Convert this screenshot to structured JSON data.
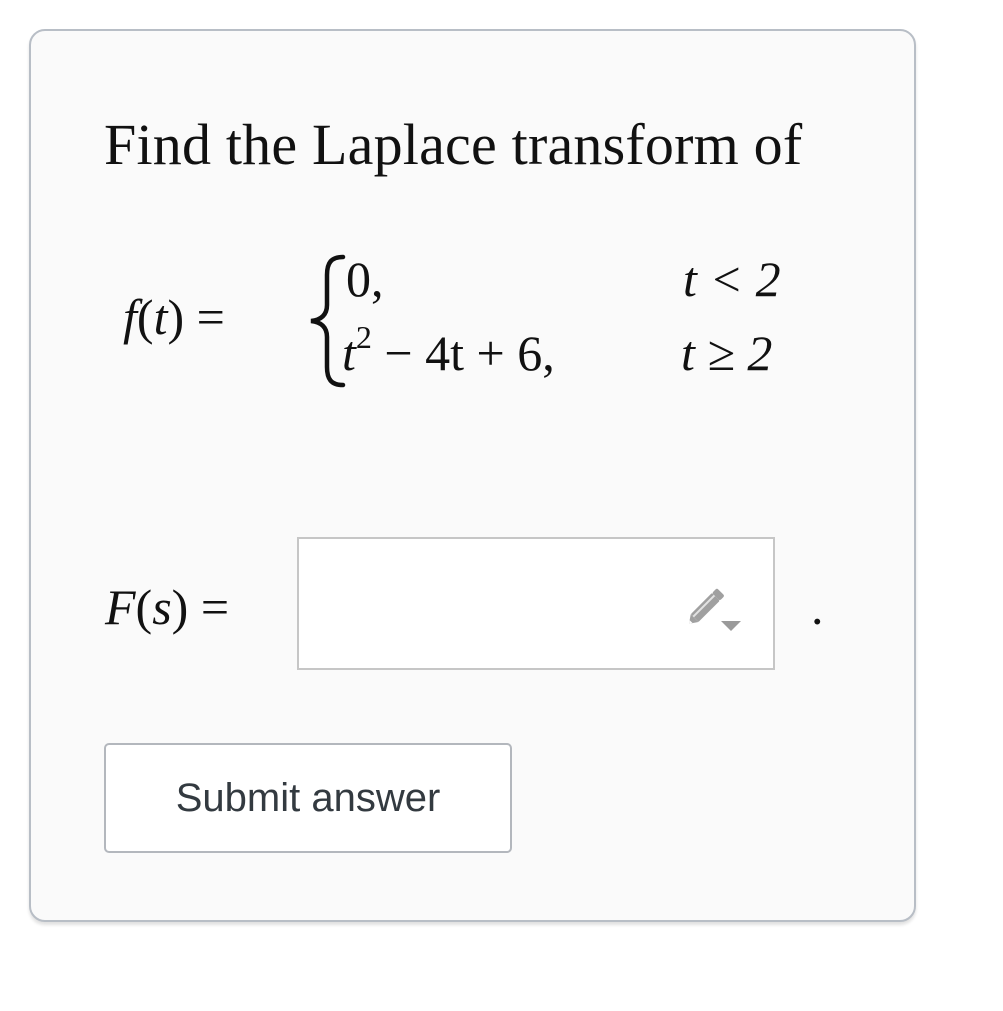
{
  "question": {
    "prompt": "Find the Laplace transform of",
    "function": {
      "lhs_name": "f",
      "lhs_var": "t",
      "equals": "=",
      "cases": [
        {
          "expression": "0,",
          "condition": "t < 2"
        },
        {
          "expression_base": "t",
          "expression_exp": "2",
          "expression_rest": " − 4t + 6,",
          "condition": "t ≥ 2"
        }
      ]
    }
  },
  "answer": {
    "lhs_name": "F",
    "lhs_var": "s",
    "equals": "=",
    "value": "",
    "trailing": ".",
    "icon": "pencil-dropdown-icon"
  },
  "submit": {
    "label": "Submit answer"
  },
  "colors": {
    "card_bg": "#fafafa",
    "card_border": "#b8bec6",
    "icon": "#9a9a9a",
    "button_text": "#333a40"
  }
}
